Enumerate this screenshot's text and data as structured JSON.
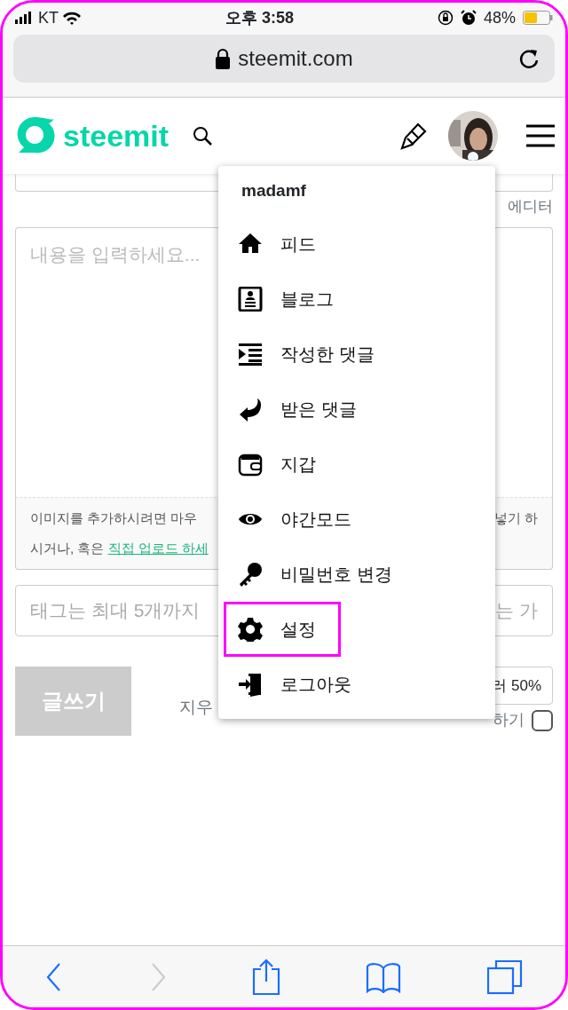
{
  "status_bar": {
    "carrier": "KT",
    "time": "오후 3:58",
    "battery": "48%"
  },
  "address_bar": {
    "url": "steemit.com"
  },
  "header": {
    "logo": "steemit"
  },
  "editor": {
    "editor_link": "에디터",
    "body": {
      "placeholder": "내용을 입력하세요..."
    },
    "help_left": "이미지를 추가하시려면 마우",
    "help_right": "넣기 하",
    "help_line2": "시거나, 혹은 ",
    "help_link": "직접 업로드 하세",
    "tags_left": "태그는 최대 5개까지",
    "tags_right": "는 가",
    "submit": "글쓰기",
    "clear": "지우",
    "reward": "러 50%",
    "option_label": "하기",
    "option_checked": false
  },
  "menu": {
    "username": "madamf",
    "items": [
      {
        "label": "피드",
        "highlighted": false
      },
      {
        "label": "블로그",
        "highlighted": false
      },
      {
        "label": "작성한 댓글",
        "highlighted": false
      },
      {
        "label": "받은 댓글",
        "highlighted": false
      },
      {
        "label": "지갑",
        "highlighted": false
      },
      {
        "label": "야간모드",
        "highlighted": false
      },
      {
        "label": "비밀번호 변경",
        "highlighted": false
      },
      {
        "label": "설정",
        "highlighted": true
      },
      {
        "label": "로그아웃",
        "highlighted": false
      }
    ]
  }
}
